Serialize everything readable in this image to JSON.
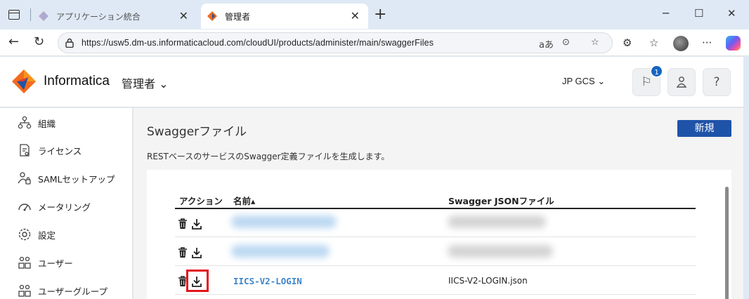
{
  "browser": {
    "tabs": [
      {
        "title": "アプリケーション統合",
        "active": false
      },
      {
        "title": "管理者",
        "active": true
      }
    ],
    "url": "https://usw5.dm-us.informaticacloud.com/cloudUI/products/administer/main/swaggerFiles",
    "url_icons": [
      "read-aloud-icon",
      "more-info-icon",
      "favorite-star-icon"
    ],
    "new_tab": "+",
    "window_controls": {
      "minimize": "─",
      "maximize": "☐",
      "close": "✕"
    }
  },
  "header": {
    "brand": "Informatica",
    "service": "管理者",
    "org": "JP GCS",
    "notification_count": "1",
    "help": "?"
  },
  "sidebar": {
    "items": [
      {
        "label": "組織",
        "icon": "org-tree-icon"
      },
      {
        "label": "ライセンス",
        "icon": "license-icon"
      },
      {
        "label": "SAMLセットアップ",
        "icon": "saml-user-lock-icon"
      },
      {
        "label": "メータリング",
        "icon": "meter-icon"
      },
      {
        "label": "設定",
        "icon": "gear-icon"
      },
      {
        "label": "ユーザー",
        "icon": "users-icon"
      },
      {
        "label": "ユーザーグループ",
        "icon": "user-group-icon"
      }
    ]
  },
  "main": {
    "title": "Swaggerファイル",
    "new_button": "新規",
    "description": "RESTベースのサービスのSwagger定義ファイルを生成します。",
    "table": {
      "headers": {
        "action": "アクション",
        "name": "名前▴",
        "json": "Swagger JSONファイル"
      },
      "rows": [
        {
          "name": "",
          "json": "",
          "redacted": true
        },
        {
          "name": "",
          "json": "",
          "redacted": true
        },
        {
          "name": "IICS-V2-LOGIN",
          "json": "IICS-V2-LOGIN.json",
          "redacted": false
        }
      ]
    }
  },
  "colors": {
    "accent": "#1f53a8",
    "link": "#3f84c8",
    "highlight": "#e3161c",
    "badge": "#1565c0"
  }
}
